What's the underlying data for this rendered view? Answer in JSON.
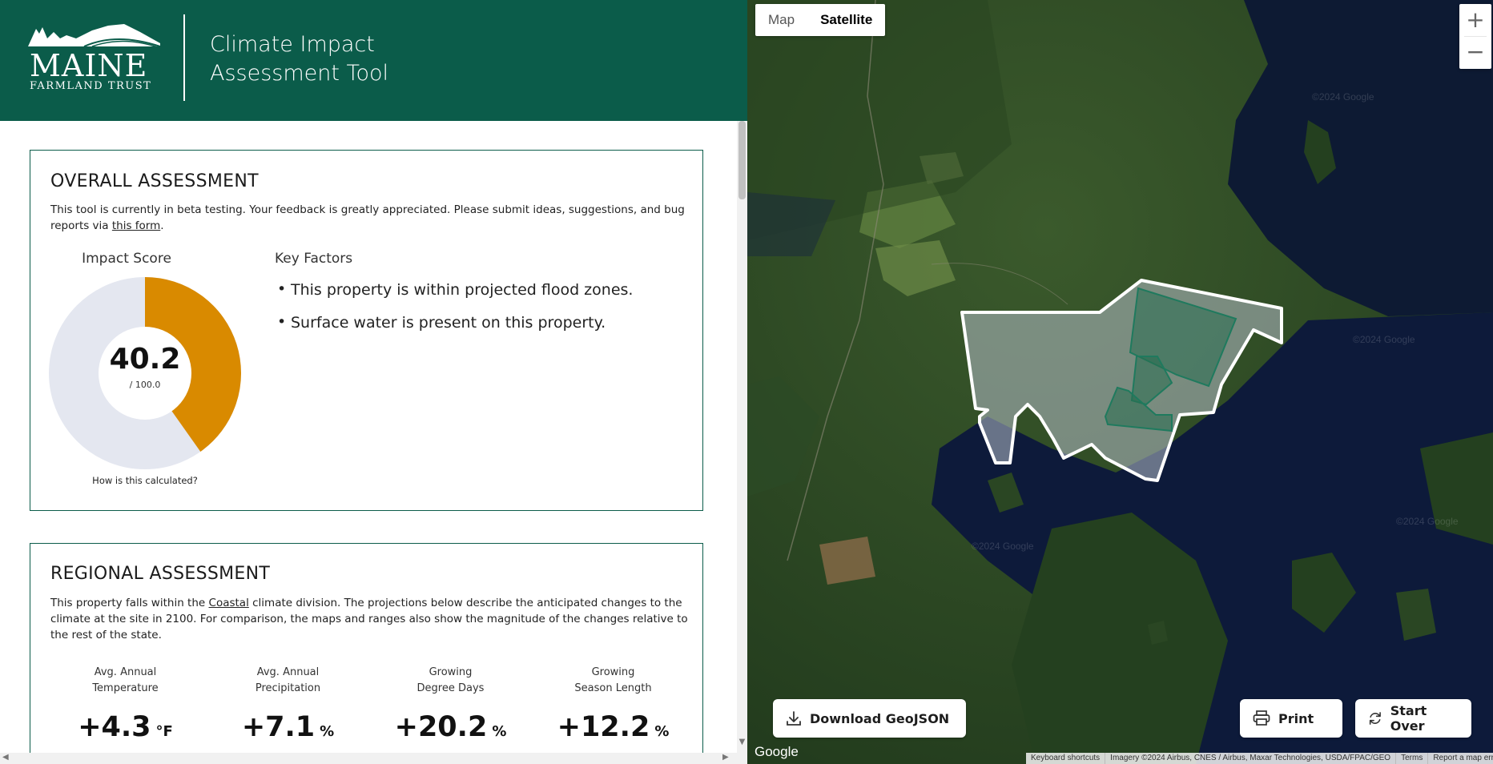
{
  "header": {
    "logo_line1": "MAINE",
    "logo_line2": "FARMLAND TRUST",
    "title_line1": "Climate Impact",
    "title_line2": "Assessment Tool"
  },
  "overall": {
    "heading": "OVERALL ASSESSMENT",
    "intro_text": "This tool is currently in beta testing. Your feedback is greatly appreciated. Please submit ideas, suggestions, and bug reports via",
    "intro_link": "this form",
    "intro_end": ".",
    "impact_title": "Impact Score",
    "score": "40.2",
    "score_max": "/ 100.0",
    "score_fraction": 0.402,
    "how_calculated": "How is this calculated?",
    "key_factors_title": "Key Factors",
    "factors": [
      "This property is within projected flood zones.",
      "Surface water is present on this property."
    ]
  },
  "regional": {
    "heading": "REGIONAL ASSESSMENT",
    "intro_before": "This property falls within the",
    "division_link": "Coastal",
    "intro_after": "climate division. The projections below describe the anticipated changes to the climate at the site in 2100. For comparison, the maps and ranges also show the magnitude of the changes relative to the rest of the state.",
    "metrics": [
      {
        "label1": "Avg. Annual",
        "label2": "Temperature",
        "value": "+4.3",
        "unit": "°F"
      },
      {
        "label1": "Avg. Annual",
        "label2": "Precipitation",
        "value": "+7.1",
        "unit": "%"
      },
      {
        "label1": "Growing",
        "label2": "Degree Days",
        "value": "+20.2",
        "unit": "%"
      },
      {
        "label1": "Growing",
        "label2": "Season Length",
        "value": "+12.2",
        "unit": "%"
      }
    ]
  },
  "map": {
    "type_map": "Map",
    "type_satellite": "Satellite",
    "zoom_in": "+",
    "zoom_out": "−",
    "download_label": "Download GeoJSON",
    "print_label": "Print",
    "start_over_label": "Start Over",
    "google": "Google",
    "attribution": [
      "Keyboard shortcuts",
      "Imagery ©2024 Airbus, CNES / Airbus, Maxar Technologies, USDA/FPAC/GEO",
      "Terms",
      "Report a map error"
    ],
    "watermark": "©2024 Google"
  },
  "colors": {
    "brand_green": "#0b5c4a",
    "score_orange": "#d98a00",
    "donut_track": "#e4e7f0"
  }
}
